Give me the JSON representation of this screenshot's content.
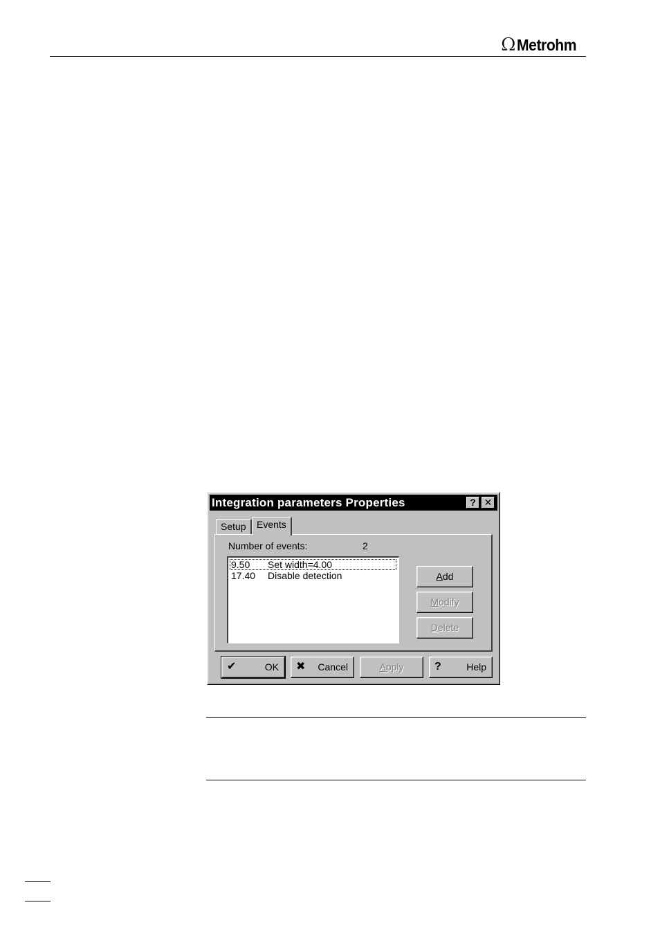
{
  "header": {
    "logo_text": "Metrohm"
  },
  "dialog": {
    "title": "Integration parameters Properties",
    "help_glyph": "?",
    "close_glyph": "✕",
    "tabs": [
      {
        "label": "Setup",
        "active": false
      },
      {
        "label": "Events",
        "active": true
      }
    ],
    "events_count_label": "Number of events:",
    "events_count": "2",
    "events": [
      {
        "time": "9.50",
        "desc": "Set width=4.00",
        "selected": true
      },
      {
        "time": "17.40",
        "desc": "Disable detection",
        "selected": false
      }
    ],
    "side_buttons": {
      "add": {
        "mnemonic": "A",
        "rest": "dd",
        "enabled": true
      },
      "modify": {
        "mnemonic": "M",
        "rest": "odify",
        "enabled": false
      },
      "delete": {
        "mnemonic": "D",
        "rest": "elete",
        "enabled": false
      }
    },
    "bottom_buttons": {
      "ok": {
        "icon": "checkmark-icon",
        "glyph": "✔",
        "label": "OK"
      },
      "cancel": {
        "icon": "x-icon",
        "glyph": "✖",
        "label": "Cancel"
      },
      "apply": {
        "mnemonic": "A",
        "rest": "pply",
        "enabled": false
      },
      "help": {
        "icon": "question-icon",
        "glyph": "?",
        "label": "Help"
      }
    }
  }
}
